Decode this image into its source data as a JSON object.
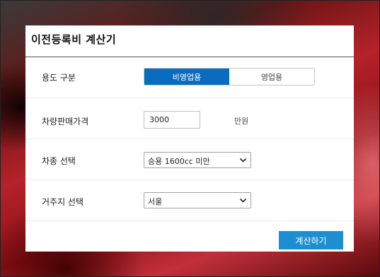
{
  "dialog": {
    "title": "이전등록비 계산기"
  },
  "usage": {
    "label": "용도 구분",
    "options": [
      "비영업용",
      "영업용"
    ],
    "selected": "비영업용"
  },
  "price": {
    "label": "차량판매가격",
    "value": "3000",
    "unit": "만원"
  },
  "car_type": {
    "label": "차종 선택",
    "selected": "승용 1600cc 미만"
  },
  "residence": {
    "label": "거주지 선택",
    "selected": "서울"
  },
  "actions": {
    "calculate_label": "계산하기"
  },
  "colors": {
    "active_segment": "#0a6cbf",
    "calculate_button": "#1d8fd0"
  }
}
